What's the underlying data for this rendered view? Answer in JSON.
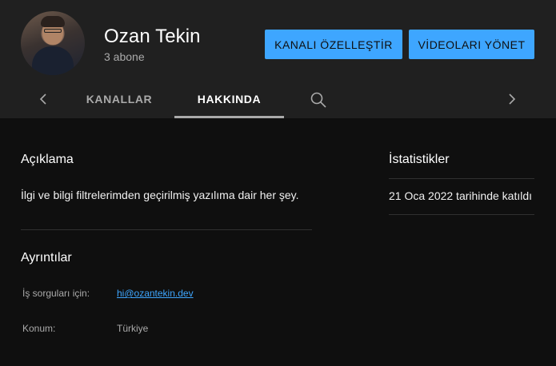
{
  "channel": {
    "name": "Ozan Tekin",
    "subscribers": "3 abone"
  },
  "buttons": {
    "customize": "KANALI ÖZELLEŞTİR",
    "manage": "VİDEOLARI YÖNET"
  },
  "tabs": [
    {
      "label": "KANALLAR",
      "active": false
    },
    {
      "label": "HAKKINDA",
      "active": true
    }
  ],
  "icons": {
    "prev": "chevron-left-icon",
    "next": "chevron-right-icon",
    "search": "search-icon"
  },
  "colors": {
    "accent": "#3ea6ff",
    "header_bg": "#202020",
    "page_bg": "#0f0f0f"
  },
  "about": {
    "description_title": "Açıklama",
    "description": "İlgi ve bilgi filtrelerimden geçirilmiş yazılıma dair her şey.",
    "details_title": "Ayrıntılar",
    "details": [
      {
        "label": "İş sorguları için:",
        "value": "hi@ozantekin.dev",
        "is_link": true
      },
      {
        "label": "Konum:",
        "value": "Türkiye",
        "is_link": false
      }
    ]
  },
  "stats": {
    "title": "İstatistikler",
    "joined": "21 Oca 2022 tarihinde katıldı"
  }
}
